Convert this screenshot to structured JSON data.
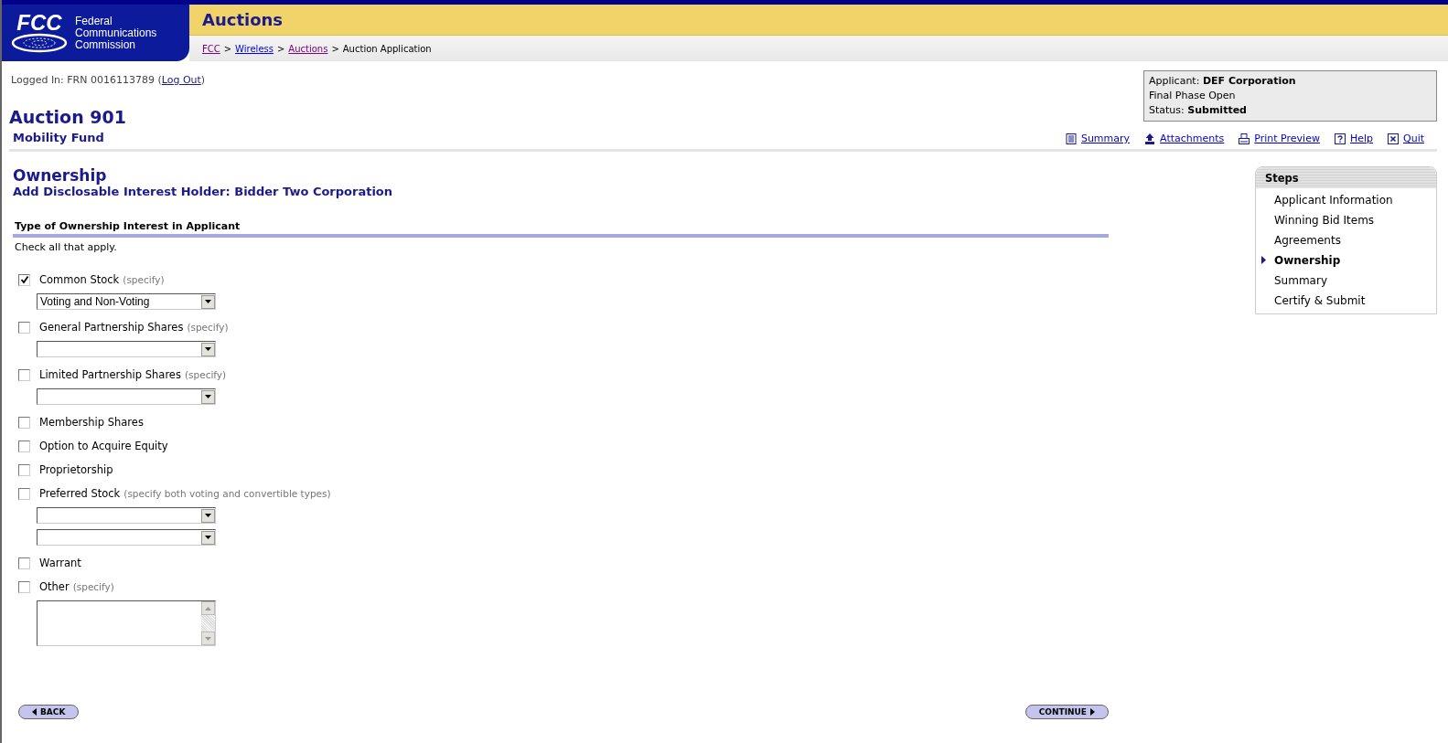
{
  "header": {
    "agency_line1": "Federal",
    "agency_line2": "Communications",
    "agency_line3": "Commission",
    "logo_text": "FCC",
    "section_title": "Auctions"
  },
  "breadcrumb": {
    "separator": ">",
    "items": [
      {
        "label": "FCC",
        "kind": "link",
        "visited": true
      },
      {
        "label": "Wireless",
        "kind": "link",
        "visited": false
      },
      {
        "label": "Auctions",
        "kind": "link",
        "visited": true
      },
      {
        "label": "Auction Application",
        "kind": "text"
      }
    ]
  },
  "login": {
    "prefix": "Logged In: FRN 0016113789 (",
    "link": "Log Out",
    "suffix": ")"
  },
  "applicant_box": [
    "Applicant: **DEF Corporation**",
    "Final Phase Open",
    "Status: **Submitted**"
  ],
  "page_title": "Auction 901",
  "page_subtitle": "Mobility Fund",
  "toolbar": [
    {
      "label": "Summary",
      "kind": "summary"
    },
    {
      "label": "Attachments",
      "kind": "attachments"
    },
    {
      "label": "Print Preview",
      "kind": "print"
    },
    {
      "label": "Help",
      "kind": "help"
    },
    {
      "label": "Quit",
      "kind": "quit"
    }
  ],
  "form": {
    "title": "Ownership",
    "subtitle": "Add Disclosable Interest Holder: Bidder Two Corporation",
    "section_heading": "Type of Ownership Interest in Applicant",
    "instruction": "Check all that apply.",
    "options": [
      {
        "label": "Common Stock",
        "hint": "(specify)",
        "checked": true,
        "fields": [
          {
            "kind": "select",
            "value": "Voting and Non-Voting"
          }
        ]
      },
      {
        "label": "General Partnership Shares",
        "hint": "(specify)",
        "checked": false,
        "fields": [
          {
            "kind": "select"
          }
        ]
      },
      {
        "label": "Limited Partnership Shares",
        "hint": "(specify)",
        "checked": false,
        "fields": [
          {
            "kind": "select"
          }
        ]
      },
      {
        "label": "Membership Shares",
        "checked": false
      },
      {
        "label": "Option to Acquire Equity",
        "checked": false
      },
      {
        "label": "Proprietorship",
        "checked": false
      },
      {
        "label": "Preferred Stock",
        "hint": "(specify both voting and convertible types)",
        "checked": false,
        "fields": [
          {
            "kind": "select"
          },
          {
            "kind": "select"
          }
        ]
      },
      {
        "label": "Warrant",
        "checked": false
      },
      {
        "label": "Other",
        "hint": "(specify)",
        "checked": false,
        "fields": [
          {
            "kind": "textarea"
          }
        ]
      }
    ]
  },
  "steps": {
    "title": "Steps",
    "items": [
      {
        "label": "Applicant Information",
        "selected": false
      },
      {
        "label": "Winning Bid Items",
        "selected": false
      },
      {
        "label": "Agreements",
        "selected": false
      },
      {
        "label": "Ownership",
        "selected": true
      },
      {
        "label": "Summary",
        "selected": false
      },
      {
        "label": "Certify & Submit",
        "selected": false
      }
    ]
  },
  "buttons": {
    "back": "BACK",
    "continue": "CONTINUE"
  }
}
